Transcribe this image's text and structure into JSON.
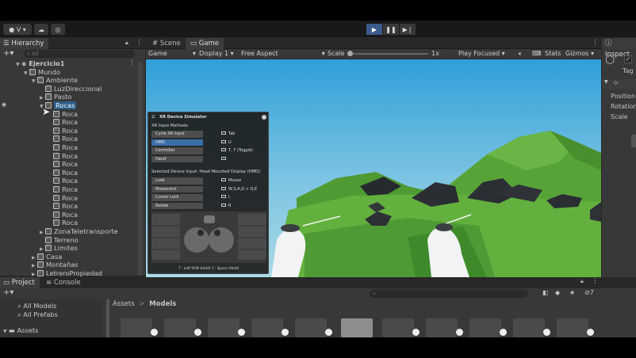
{
  "toolbar": {
    "account_label": "V",
    "play_icon": "play-icon",
    "pause_icon": "pause-icon",
    "step_icon": "step-icon"
  },
  "hierarchy": {
    "tab_label": "Hierarchy",
    "search_placeholder": "All",
    "scene_name": "Ejercicio1",
    "items": [
      {
        "label": "Mundo",
        "depth": 1,
        "expanded": true
      },
      {
        "label": "Ambiente",
        "depth": 2,
        "expanded": true
      },
      {
        "label": "LuzDireccional",
        "depth": 3
      },
      {
        "label": "Pasto",
        "depth": 3,
        "collapsed": true
      },
      {
        "label": "Rocas",
        "depth": 3,
        "expanded": true,
        "selected": true
      },
      {
        "label": "Roca",
        "depth": 4
      },
      {
        "label": "Roca",
        "depth": 4
      },
      {
        "label": "Roca",
        "depth": 4
      },
      {
        "label": "Roca",
        "depth": 4
      },
      {
        "label": "Roca",
        "depth": 4
      },
      {
        "label": "Roca",
        "depth": 4
      },
      {
        "label": "Roca",
        "depth": 4
      },
      {
        "label": "Roca",
        "depth": 4
      },
      {
        "label": "Roca",
        "depth": 4
      },
      {
        "label": "Roca",
        "depth": 4
      },
      {
        "label": "Roca",
        "depth": 4
      },
      {
        "label": "Roca",
        "depth": 4
      },
      {
        "label": "Roca",
        "depth": 4
      },
      {
        "label": "Roca",
        "depth": 4
      },
      {
        "label": "ZonaTeletransporte",
        "depth": 3,
        "collapsed": true
      },
      {
        "label": "Terreno",
        "depth": 3
      },
      {
        "label": "Limites",
        "depth": 3,
        "collapsed": true
      },
      {
        "label": "Casa",
        "depth": 2,
        "collapsed": true
      },
      {
        "label": "Montañas",
        "depth": 2,
        "collapsed": true
      },
      {
        "label": "LetreroPropiedad",
        "depth": 2,
        "collapsed": true
      }
    ]
  },
  "view_tabs": {
    "scene": "Scene",
    "game": "Game"
  },
  "game_bar": {
    "mode": "Game",
    "display": "Display 1",
    "aspect": "Free Aspect",
    "scale_label": "Scale",
    "scale_value": "1x",
    "play_focused": "Play Focused",
    "stats": "Stats",
    "gizmos": "Gizmos"
  },
  "xr_sim": {
    "title": "XR Device Simulator",
    "input_methods_label": "XR Input Methods",
    "methods": [
      {
        "label": "Cycle XR Input",
        "key": "Tab",
        "active": false
      },
      {
        "label": "HMD",
        "key": "U",
        "active": true
      },
      {
        "label": "Controller",
        "key": "T, Y (Toggle)",
        "active": false
      },
      {
        "label": "Hand",
        "key": "",
        "active": false
      }
    ],
    "selected_device": "Selected Device Input: Head Mounted Display (HMD)",
    "controls": [
      {
        "label": "Look",
        "key": "Mouse"
      },
      {
        "label": "Movement",
        "key": "W,S,A,D + Q,E"
      },
      {
        "label": "Cursor Lock",
        "key": "\\"
      },
      {
        "label": "Rotate",
        "key": "R"
      }
    ],
    "footer": "T : Left Shift (Hold)  Y : Space (Hold)"
  },
  "inspector": {
    "tab_label": "Inspect",
    "tag_label": "Tag",
    "fields": [
      "Position",
      "Rotation",
      "Scale"
    ]
  },
  "bottom": {
    "project_tab": "Project",
    "console_tab": "Console",
    "favorites": [
      "All Models",
      "All Prefabs"
    ],
    "assets_root": "Assets",
    "breadcrumb": [
      "Assets",
      "Models"
    ],
    "hidden_count": "7"
  },
  "colors": {
    "selection": "#2c5d87",
    "sky_top": "#2d9fd8",
    "grass": "#5aa73a",
    "play_active": "#3a5b8c"
  }
}
